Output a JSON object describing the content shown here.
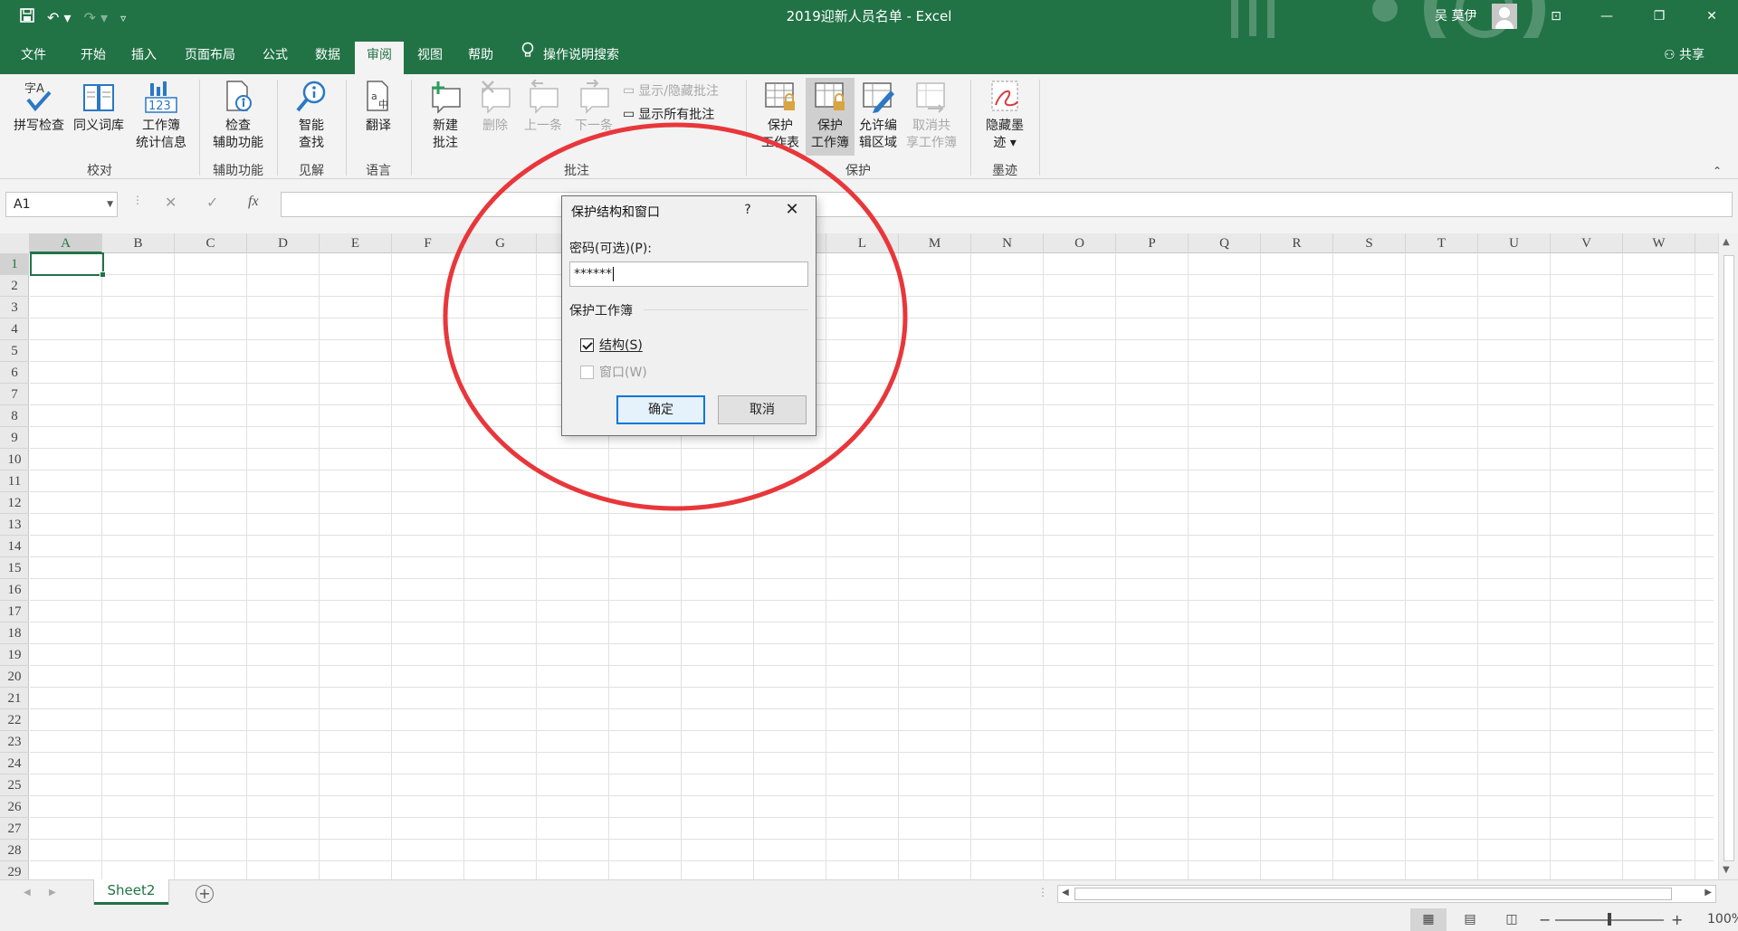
{
  "window": {
    "title": "2019迎新人员名单  -  Excel",
    "user_name": "吴 莫伊",
    "controls": {
      "ribbon_display": "⊡",
      "minimize": "—",
      "restore": "❐",
      "close": "✕"
    }
  },
  "qat": {
    "save_icon": "save-icon",
    "undo_icon": "undo-icon",
    "redo_icon": "redo-icon",
    "customize_icon": "customize-qat-icon"
  },
  "menu": {
    "tabs": [
      "文件",
      "开始",
      "插入",
      "页面布局",
      "公式",
      "数据",
      "审阅",
      "视图",
      "帮助"
    ],
    "active_tab": "审阅",
    "tell_me": "操作说明搜索",
    "share": "共享"
  },
  "ribbon": {
    "groups": {
      "proofing": "校对",
      "accessibility": "辅助功能",
      "insights": "见解",
      "language": "语言",
      "comments": "批注",
      "protect": "保护",
      "ink": "墨迹"
    },
    "buttons": {
      "spelling": "拼写检查",
      "thesaurus": "同义词库",
      "workbook_stats_1": "工作簿",
      "workbook_stats_2": "统计信息",
      "check_access_1": "检查",
      "check_access_2": "辅助功能",
      "smart_lookup_1": "智能",
      "smart_lookup_2": "查找",
      "translate": "翻译",
      "new_comment_1": "新建",
      "new_comment_2": "批注",
      "delete": "删除",
      "previous": "上一条",
      "next": "下一条",
      "show_hide_comment": "显示/隐藏批注",
      "show_all_comments": "显示所有批注",
      "protect_sheet_1": "保护",
      "protect_sheet_2": "工作表",
      "protect_workbook_1": "保护",
      "protect_workbook_2": "工作簿",
      "allow_edit_1": "允许编",
      "allow_edit_2": "辑区域",
      "unshare_1": "取消共",
      "unshare_2": "享工作簿",
      "hide_ink_1": "隐藏墨",
      "hide_ink_2": "迹 ▾"
    }
  },
  "formula_bar": {
    "name_box": "A1",
    "cancel_icon": "✕",
    "enter_icon": "✓",
    "fx": "fx",
    "value": ""
  },
  "sheet": {
    "columns": [
      "A",
      "B",
      "C",
      "D",
      "E",
      "F",
      "G",
      "H",
      "I",
      "J",
      "K",
      "L",
      "M",
      "N",
      "O",
      "P",
      "Q",
      "R",
      "S",
      "T",
      "U",
      "V",
      "W"
    ],
    "rows": [
      "1",
      "2",
      "3",
      "4",
      "5",
      "6",
      "7",
      "8",
      "9",
      "10",
      "11",
      "12",
      "13",
      "14",
      "15",
      "16",
      "17",
      "18",
      "19",
      "20",
      "21",
      "22",
      "23",
      "24",
      "25",
      "26",
      "27",
      "28",
      "29"
    ],
    "active_cell": "A1",
    "tab_name": "Sheet2",
    "add_sheet": "+"
  },
  "status": {
    "zoom": "100%",
    "zoom_out": "−",
    "zoom_in": "+",
    "zoom_percent": 100
  },
  "dialog": {
    "title": "保护结构和窗口",
    "help": "?",
    "close": "✕",
    "password_label": "密码(可选)(P):",
    "password_value": "******",
    "group_label": "保护工作簿",
    "structure_label": "结构(S)",
    "structure_checked": true,
    "windows_label": "窗口(W)",
    "windows_checked": false,
    "windows_enabled": false,
    "ok": "确定",
    "cancel": "取消"
  },
  "annotation": {
    "ellipse_color": "#e8373b"
  },
  "colors": {
    "excel_green": "#217346",
    "ribbon_bg": "#f3f3f3",
    "dialog_accent": "#0078d7"
  }
}
